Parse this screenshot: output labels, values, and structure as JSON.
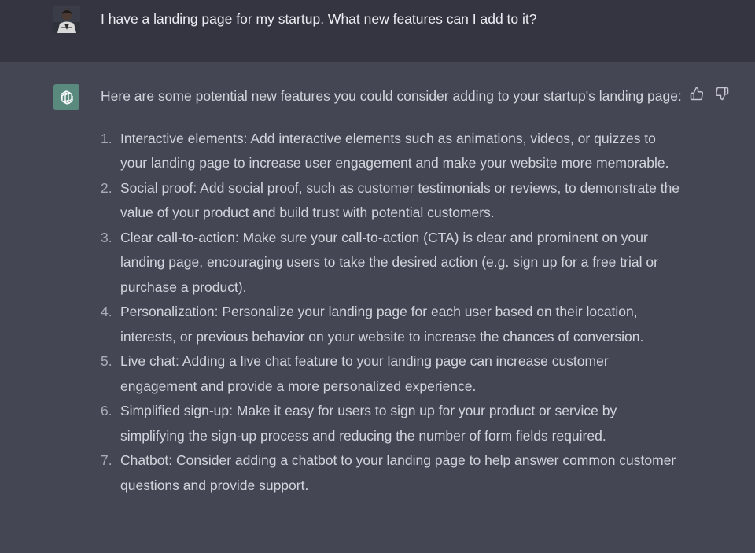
{
  "user": {
    "message": "I have a landing page for my startup. What new features can I add to it?"
  },
  "assistant": {
    "intro": "Here are some potential new features you could consider adding to your startup's landing page:",
    "items": [
      {
        "num": "1.",
        "text": "Interactive elements: Add interactive elements such as animations, videos, or quizzes to your landing page to increase user engagement and make your website more memorable."
      },
      {
        "num": "2.",
        "text": "Social proof: Add social proof, such as customer testimonials or reviews, to demonstrate the value of your product and build trust with potential customers."
      },
      {
        "num": "3.",
        "text": "Clear call-to-action: Make sure your call-to-action (CTA) is clear and prominent on your landing page, encouraging users to take the desired action (e.g. sign up for a free trial or purchase a product)."
      },
      {
        "num": "4.",
        "text": "Personalization: Personalize your landing page for each user based on their location, interests, or previous behavior on your website to increase the chances of conversion."
      },
      {
        "num": "5.",
        "text": "Live chat: Adding a live chat feature to your landing page can increase customer engagement and provide a more personalized experience."
      },
      {
        "num": "6.",
        "text": "Simplified sign-up: Make it easy for users to sign up for your product or service by simplifying the sign-up process and reducing the number of form fields required."
      },
      {
        "num": "7.",
        "text": "Chatbot: Consider adding a chatbot to your landing page to help answer common customer questions and provide support."
      }
    ]
  },
  "icons": {
    "user_avatar": "user-avatar-photo",
    "bot_avatar": "openai-logo-icon",
    "thumbs_up": "thumbs-up-icon",
    "thumbs_down": "thumbs-down-icon"
  },
  "colors": {
    "user_row_bg": "#343541",
    "assistant_row_bg": "#444654",
    "bot_avatar_bg": "#5a8a7e",
    "text": "#d1d5db"
  }
}
